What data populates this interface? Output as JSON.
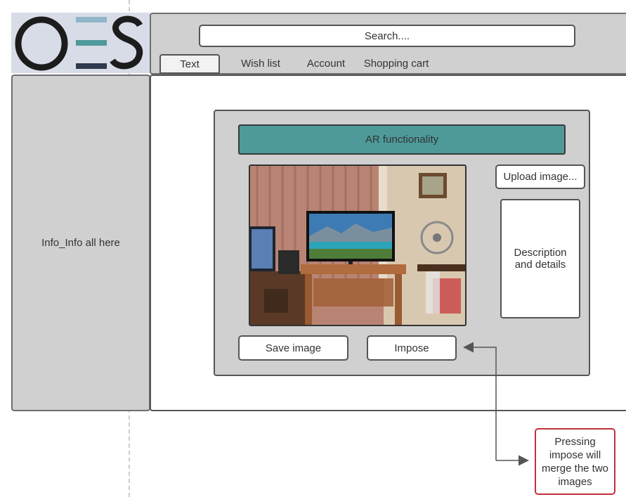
{
  "logo": {
    "text": "OES",
    "colors": {
      "letters": "#1c1c1c",
      "bars_light": "#8fb7c9",
      "bar_mid": "#4e9a9a",
      "bar_dark": "#2f3a4e"
    }
  },
  "header": {
    "search": {
      "placeholder": "Search...."
    },
    "tabs": [
      {
        "label": "Text",
        "active": true
      },
      {
        "label": "Wish list"
      },
      {
        "label": "Account"
      },
      {
        "label": "Shopping cart"
      }
    ]
  },
  "sidebar": {
    "text": "Info_Info all here"
  },
  "ar_panel": {
    "title": "AR functionality",
    "upload_label": "Upload image...",
    "description": "Description and details",
    "save_label": "Save image",
    "impose_label": "Impose",
    "accent_color": "#4e9a9a"
  },
  "annotation": {
    "text": "Pressing impose will merge the two images",
    "border_color": "#c0313b"
  }
}
